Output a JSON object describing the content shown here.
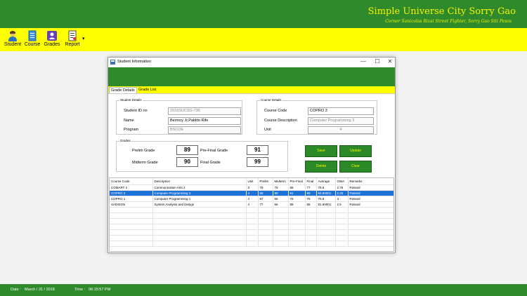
{
  "header": {
    "title": "Simple Universe City Sorry Gao",
    "subtitle": "Corner Sanicolas Rizal Street Fighter, Sorry Gao Siti Pesos"
  },
  "toolbar": {
    "items": [
      {
        "label": "Student",
        "icon": "student-icon"
      },
      {
        "label": "Course",
        "icon": "course-icon"
      },
      {
        "label": "Grades",
        "icon": "grades-icon"
      },
      {
        "label": "Report",
        "icon": "report-icon"
      }
    ],
    "more": "▾"
  },
  "window": {
    "title": "Student Information",
    "controls": {
      "minimize": "—",
      "maximize": "☐",
      "close": "✕"
    },
    "tabs": [
      "Grade Details",
      "Grade List"
    ]
  },
  "student_details": {
    "group_title": "Student Details",
    "id_label": "Student ID no",
    "id_value": "2016SUCSG-736",
    "name_label": "Name",
    "name_value": "Bermoy Jr,Pablito Rife",
    "program_label": "Program",
    "program_value": "BSCOE"
  },
  "course_details": {
    "group_title": "Course Details",
    "code_label": "Course Code",
    "code_value": "COPRO 3",
    "desc_label": "Course Description",
    "desc_value": "Computer Programming 3",
    "unit_label": "Unit",
    "unit_value": "4"
  },
  "grades": {
    "group_title": "Grades",
    "prelim_label": "Prelim Grade",
    "prelim_value": "89",
    "prefinal_label": "Pre-Final Grade",
    "prefinal_value": "91",
    "midterm_label": "Midterm Grade",
    "midterm_value": "90",
    "final_label": "Final Grade",
    "final_value": "99"
  },
  "buttons": {
    "save": "Save",
    "update": "Update",
    "delete": "Delete",
    "clear": "Clear"
  },
  "table": {
    "columns": [
      "Course Code",
      "Description",
      "Unit",
      "Prelim",
      "Midterm",
      "Pre-Final",
      "Final",
      "Average",
      "GWA",
      "Remarks"
    ],
    "rows": [
      [
        "COMART 2",
        "Communication Arts 2",
        "3",
        "76",
        "76",
        "88",
        "77",
        "78.8",
        "2.75",
        "Passed"
      ],
      [
        "COPRO 3",
        "Computer Programming 3",
        "4",
        "89",
        "90",
        "91",
        "99",
        "93.60001",
        "2.25",
        "Passed"
      ],
      [
        "COPRO 1",
        "Computer Programming 1",
        "4",
        "87",
        "66",
        "76",
        "75",
        "75.8",
        "3",
        "Passed"
      ],
      [
        "SADSIGN",
        "System Analysis and Design",
        "4",
        "77",
        "66",
        "89",
        "88",
        "81.60001",
        "2.5",
        "Passed"
      ]
    ],
    "selected_row": 1
  },
  "status": {
    "date_label": "Date :",
    "date_value": "March / 31 / 2018",
    "time_label": "Time :",
    "time_value": "06:15:57 PM"
  }
}
